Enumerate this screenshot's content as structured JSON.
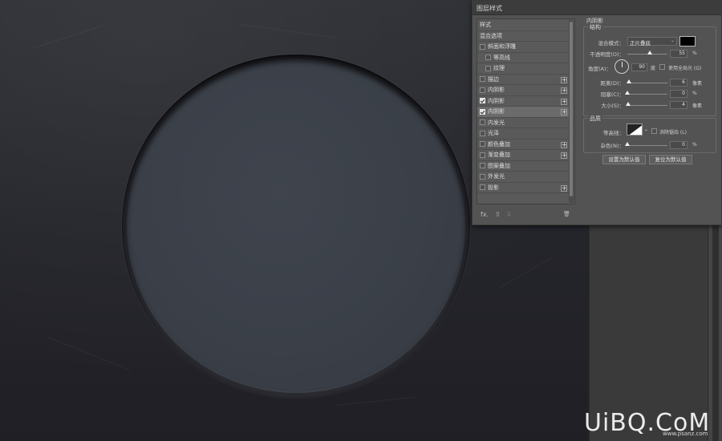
{
  "dialog": {
    "title": "图层样式",
    "styles_list": [
      {
        "label": "样式",
        "checkbox": false,
        "checked": false,
        "plus": false,
        "indent": false,
        "selected": false
      },
      {
        "label": "混合选项",
        "checkbox": false,
        "checked": false,
        "plus": false,
        "indent": false,
        "selected": false
      },
      {
        "label": "斜面和浮雕",
        "checkbox": true,
        "checked": false,
        "plus": false,
        "indent": false,
        "selected": false
      },
      {
        "label": "等高线",
        "checkbox": true,
        "checked": false,
        "plus": false,
        "indent": true,
        "selected": false
      },
      {
        "label": "纹理",
        "checkbox": true,
        "checked": false,
        "plus": false,
        "indent": true,
        "selected": false
      },
      {
        "label": "描边",
        "checkbox": true,
        "checked": false,
        "plus": true,
        "indent": false,
        "selected": false
      },
      {
        "label": "内阴影",
        "checkbox": true,
        "checked": false,
        "plus": true,
        "indent": false,
        "selected": false
      },
      {
        "label": "内阴影",
        "checkbox": true,
        "checked": true,
        "plus": true,
        "indent": false,
        "selected": false
      },
      {
        "label": "内阴影",
        "checkbox": true,
        "checked": true,
        "plus": true,
        "indent": false,
        "selected": true
      },
      {
        "label": "内发光",
        "checkbox": true,
        "checked": false,
        "plus": false,
        "indent": false,
        "selected": false
      },
      {
        "label": "光泽",
        "checkbox": true,
        "checked": false,
        "plus": false,
        "indent": false,
        "selected": false
      },
      {
        "label": "颜色叠加",
        "checkbox": true,
        "checked": false,
        "plus": true,
        "indent": false,
        "selected": false
      },
      {
        "label": "渐变叠加",
        "checkbox": true,
        "checked": false,
        "plus": true,
        "indent": false,
        "selected": false
      },
      {
        "label": "图案叠加",
        "checkbox": true,
        "checked": false,
        "plus": false,
        "indent": false,
        "selected": false
      },
      {
        "label": "外发光",
        "checkbox": true,
        "checked": false,
        "plus": false,
        "indent": false,
        "selected": false
      },
      {
        "label": "投影",
        "checkbox": true,
        "checked": false,
        "plus": true,
        "indent": false,
        "selected": false
      }
    ],
    "footer_icons": [
      "fx-icon",
      "arrow-up-icon",
      "arrow-down-icon",
      "trash-icon"
    ],
    "footer_fx": "fx.",
    "footer_up": "⇧",
    "footer_down": "⇩",
    "footer_trash": "🗑",
    "inner_shadow": {
      "section_title": "内阴影",
      "structure_title": "结构",
      "blend_mode_label": "混合模式：",
      "blend_mode_value": "正片叠底",
      "shadow_color": "#000000",
      "opacity_label": "不透明度(O)：",
      "opacity_value": "55",
      "opacity_unit": "%",
      "opacity_level": 0.55,
      "angle_label": "角度(A)：",
      "angle_value": "90",
      "angle_unit": "度",
      "global_light_label": "使用全局光 (G)",
      "distance_label": "距离(D)：",
      "distance_value": "6",
      "distance_unit": "像素",
      "distance_level": 0.04,
      "choke_label": "阻塞(C)：",
      "choke_value": "0",
      "choke_unit": "%",
      "choke_level": 0,
      "size_label": "大小(S)：",
      "size_value": "4",
      "size_unit": "像素",
      "size_level": 0.02,
      "quality_title": "品质",
      "contour_label": "等高线：",
      "anti_alias_label": "消除锯齿 (L)",
      "noise_label": "杂色(N)：",
      "noise_value": "0",
      "noise_unit": "%",
      "noise_level": 0,
      "set_default_button": "设置为默认值",
      "reset_default_button": "复位为默认值"
    }
  },
  "watermark": {
    "logo": "UiBQ.CoM",
    "url": "www.psanz.com"
  }
}
